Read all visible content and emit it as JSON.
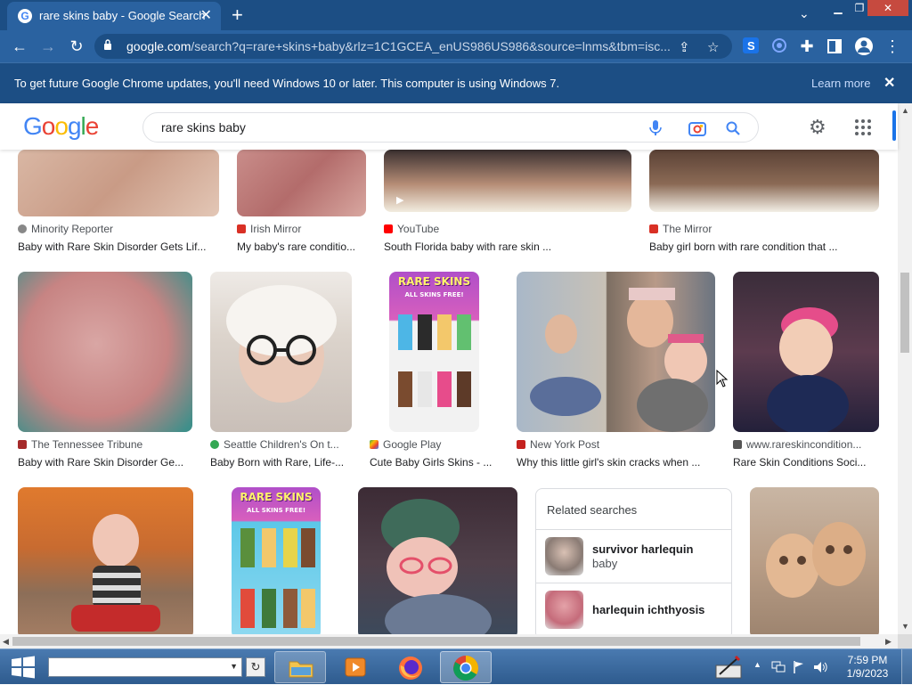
{
  "browser": {
    "tab_title": "rare skins baby - Google Search",
    "url_host": "google.com",
    "url_path": "/search?q=rare+skins+baby&rlz=1C1GCEA_enUS986US986&source=lnms&tbm=isc...",
    "favicon_letter": "G",
    "new_tab_glyph": "+",
    "close_glyph": "✕"
  },
  "infobar": {
    "message": "To get future Google Chrome updates, you'll need Windows 10 or later. This computer is using Windows 7.",
    "learn_more": "Learn more",
    "close_glyph": "✕"
  },
  "google": {
    "logo_letters": [
      "G",
      "o",
      "o",
      "g",
      "l",
      "e"
    ],
    "logo_colors": [
      "#4285F4",
      "#EA4335",
      "#FBBC05",
      "#4285F4",
      "#34A853",
      "#EA4335"
    ],
    "query": "rare skins baby"
  },
  "results_row1": [
    {
      "source": "Minority Reporter",
      "title": "Baby with Rare Skin Disorder Gets Lif..."
    },
    {
      "source": "Irish Mirror",
      "title": "My baby's rare conditio..."
    },
    {
      "source": "YouTube",
      "title": "South Florida baby with rare skin ..."
    },
    {
      "source": "The Mirror",
      "title": "Baby girl born with rare condition that ..."
    }
  ],
  "results_row2": [
    {
      "source": "The Tennessee Tribune",
      "title": "Baby with Rare Skin Disorder Ge..."
    },
    {
      "source": "Seattle Children's On t...",
      "title": "Baby Born with Rare, Life-..."
    },
    {
      "source": "Google Play",
      "title": "Cute Baby Girls Skins - ...",
      "image_text_1": "RARE SKINS",
      "image_text_2": "ALL SKINS FREE!"
    },
    {
      "source": "New York Post",
      "title": "Why this little girl's skin cracks when ..."
    },
    {
      "source": "www.rareskincondition...",
      "title": "Rare Skin Conditions Soci..."
    }
  ],
  "results_row3": [
    {
      "image_text_1": "RARE SKINS",
      "image_text_2": "ALL SKINS FREE!"
    }
  ],
  "related": {
    "heading": "Related searches",
    "items": [
      {
        "line1": "survivor harlequin",
        "line2": "baby"
      },
      {
        "line1": "harlequin ichthyosis",
        "line2": ""
      }
    ]
  },
  "taskbar": {
    "time": "7:59 PM",
    "date": "1/9/2023",
    "refresh_glyph": "↻"
  }
}
